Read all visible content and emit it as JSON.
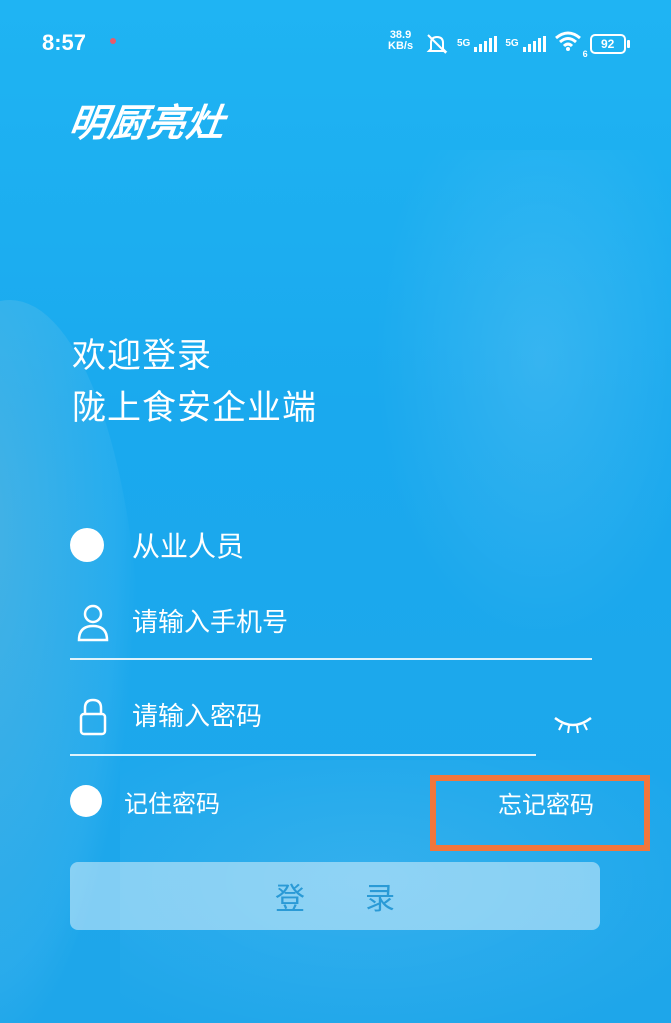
{
  "status_bar": {
    "time": "8:57",
    "net_speed_value": "38.9",
    "net_speed_unit": "KB/s",
    "sig1_label": "5G",
    "sig2_label": "5G",
    "wifi_badge": "6",
    "battery": "92"
  },
  "logo_text": "明厨亮灶",
  "welcome": {
    "line1": "欢迎登录",
    "line2": "陇上食安企业端"
  },
  "role": {
    "label": "从业人员"
  },
  "phone_field": {
    "placeholder": "请输入手机号"
  },
  "password_field": {
    "placeholder": "请输入密码"
  },
  "remember": {
    "label": "记住密码"
  },
  "forgot_label": "忘记密码",
  "login_button": {
    "label": "登录"
  },
  "colors": {
    "background": "#1fb4f3",
    "highlight_border": "#f2763c",
    "button_text": "#2a9ad6"
  }
}
